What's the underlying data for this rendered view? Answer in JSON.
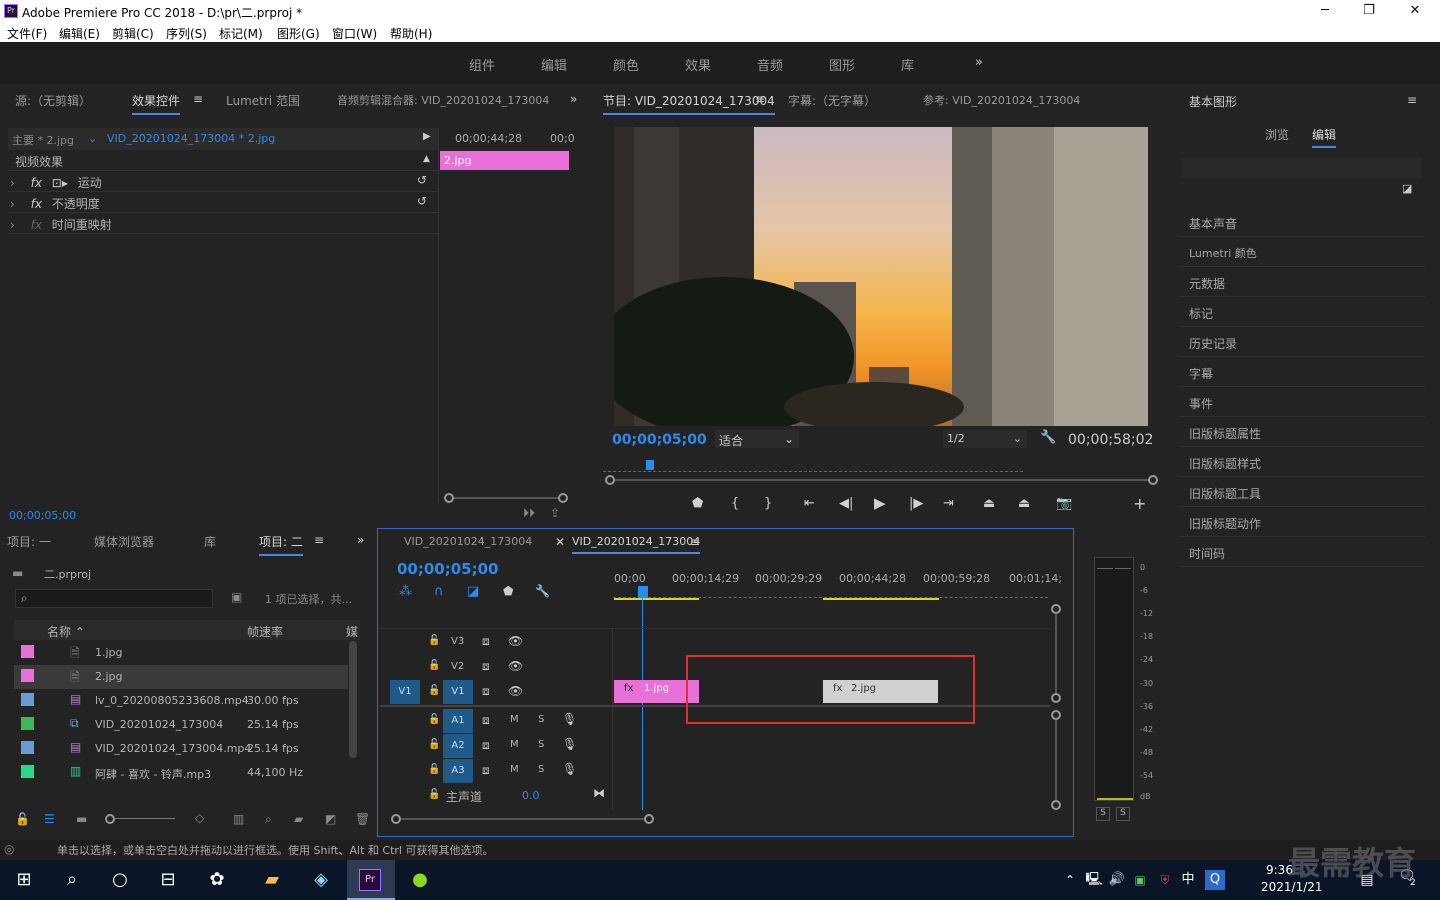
{
  "window": {
    "title": "Adobe Premiere Pro CC 2018 - D:\\pr\\二.prproj *",
    "min": "─",
    "max": "❐",
    "close": "✕"
  },
  "menu": [
    "文件(F)",
    "编辑(E)",
    "剪辑(C)",
    "序列(S)",
    "标记(M)",
    "图形(G)",
    "窗口(W)",
    "帮助(H)"
  ],
  "workspaces": [
    "组件",
    "编辑",
    "颜色",
    "效果",
    "音频",
    "图形",
    "库"
  ],
  "source_panel": {
    "tabs": [
      "源:（无剪辑）",
      "效果控件",
      "Lumetri 范围",
      "音频剪辑混合器: VID_20201024_173004"
    ],
    "master": "主要 * 2.jpg",
    "clip": "VID_20201024_173004 * 2.jpg",
    "time_head": "00;00;44;28",
    "time_head2": "00;0",
    "clip_bar": "2.jpg",
    "video_effects": "视频效果",
    "effects": [
      "运动",
      "不透明度",
      "时间重映射"
    ],
    "timecode": "00;00;05;00"
  },
  "program_panel": {
    "tabs": [
      "节目: VID_20201024_173004",
      "字幕:（无字幕）",
      "参考: VID_20201024_173004"
    ],
    "timecode": "00;00;05;00",
    "fit": "适合",
    "res": "1/2",
    "duration": "00;00;58;02"
  },
  "project_panel": {
    "tabs": [
      "项目: 一",
      "媒体浏览器",
      "库",
      "项目: 二"
    ],
    "name": "二.prproj",
    "search_placeholder": "",
    "status": "1 项已选择，共...",
    "headers": [
      "名称",
      "帧速率",
      "媒"
    ],
    "items": [
      {
        "name": "1.jpg",
        "fps": "",
        "color": "#e870d8"
      },
      {
        "name": "2.jpg",
        "fps": "",
        "color": "#e870d8"
      },
      {
        "name": "lv_0_20200805233608.mp4",
        "fps": "30.00 fps",
        "color": "#6a9ad8"
      },
      {
        "name": "VID_20201024_173004",
        "fps": "25.14 fps",
        "color": "#3ab85a"
      },
      {
        "name": "VID_20201024_173004.mp4",
        "fps": "25.14 fps",
        "color": "#6a9ad8"
      },
      {
        "name": "阿肆 - 喜欢 - 铃声.mp3",
        "fps": "44,100 Hz",
        "color": "#2ad88a"
      }
    ]
  },
  "timeline": {
    "tabs": [
      "VID_20201024_173004",
      "VID_20201024_173004"
    ],
    "timecode": "00;00;05;00",
    "ruler": [
      "00;00",
      "00;00;14;29",
      "00;00;29;29",
      "00;00;44;28",
      "00;00;59;28",
      "00;01;14;"
    ],
    "video_tracks": [
      "V3",
      "V2",
      "V1"
    ],
    "audio_tracks": [
      "A1",
      "A2",
      "A3"
    ],
    "src_patch": "V1",
    "master": "主声道",
    "master_val": "0.0",
    "clips": [
      {
        "name": "1.jpg"
      },
      {
        "name": "2.jpg"
      }
    ],
    "ms": [
      "M",
      "S"
    ]
  },
  "meter": {
    "scale": [
      "0",
      "-6",
      "-12",
      "-18",
      "-24",
      "-30",
      "-36",
      "-42",
      "-48",
      "-54",
      "dB"
    ],
    "solo": [
      "S",
      "S"
    ]
  },
  "graphics_panel": {
    "title": "基本图形",
    "tabs": [
      "浏览",
      "编辑"
    ],
    "items": [
      "基本声音",
      "Lumetri 颜色",
      "元数据",
      "标记",
      "历史记录",
      "字幕",
      "事件",
      "旧版标题属性",
      "旧版标题样式",
      "旧版标题工具",
      "旧版标题动作",
      "时间码"
    ]
  },
  "statusbar": {
    "text": "单击以选择，或单击空白处并拖动以进行框选。使用 Shift、Alt 和 Ctrl 可获得其他选项。"
  },
  "taskbar": {
    "time": "9:36",
    "date": "2021/1/21",
    "ime": "中",
    "notif": "2",
    "watermark": "最需教育"
  },
  "colors": {
    "accent": "#2d8ceb",
    "clip_pink": "#e870d8",
    "highlight_box": "#e03030"
  }
}
